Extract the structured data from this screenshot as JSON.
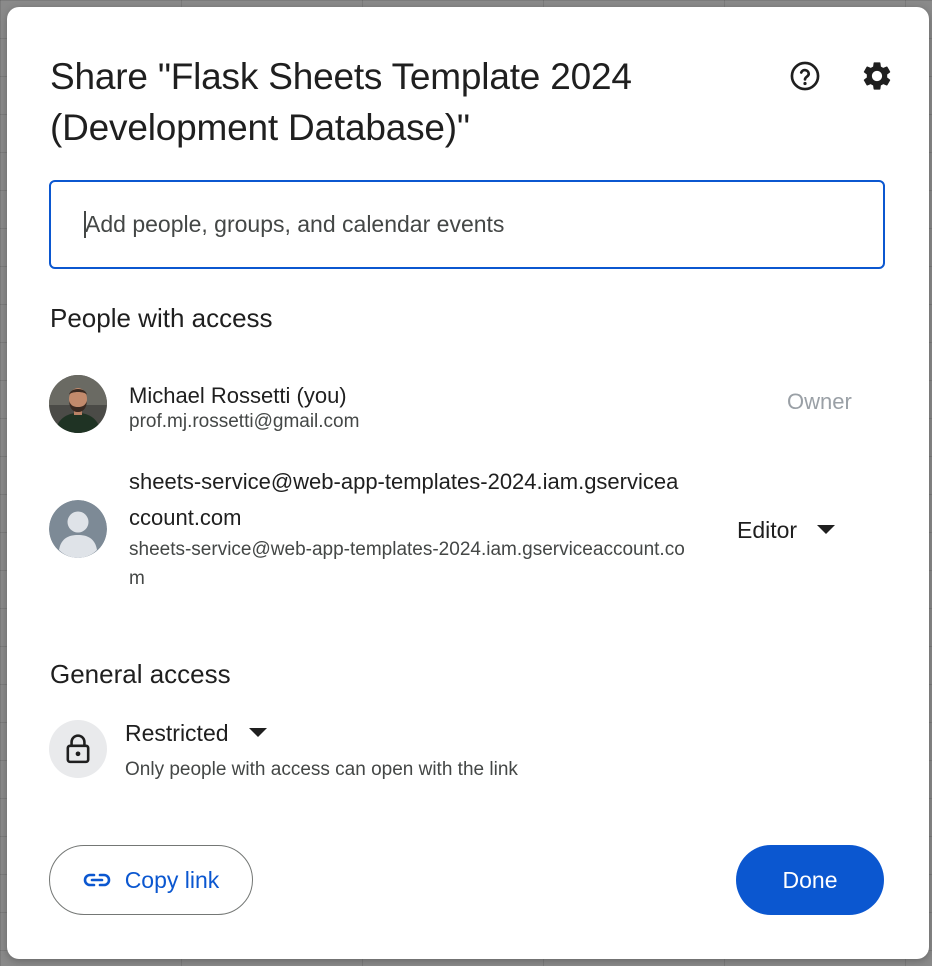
{
  "dialog": {
    "title": "Share \"Flask Sheets Template 2024 (Development Database)\"",
    "help_icon": "help-circle-icon",
    "settings_icon": "gear-icon"
  },
  "search": {
    "placeholder": "Add people, groups, and calendar events",
    "value": ""
  },
  "people_section": {
    "title": "People with access",
    "people": [
      {
        "name": "Michael Rossetti (you)",
        "email": "prof.mj.rossetti@gmail.com",
        "role": "Owner",
        "avatar": "photo"
      },
      {
        "name": "sheets-service@web-app-templates-2024.iam.gserviceaccount.com",
        "email": "sheets-service@web-app-templates-2024.iam.gserviceaccount.com",
        "role": "Editor",
        "avatar": "default-person-icon"
      }
    ]
  },
  "general_access": {
    "title": "General access",
    "setting": "Restricted",
    "description": "Only people with access can open with the link",
    "icon": "lock-icon"
  },
  "footer": {
    "copy_link_label": "Copy link",
    "copy_link_icon": "link-icon",
    "done_label": "Done"
  },
  "colors": {
    "accent": "#0b57d0",
    "text_primary": "#1f1f1f",
    "text_secondary": "#444746",
    "owner_text": "#9aa0a6"
  }
}
